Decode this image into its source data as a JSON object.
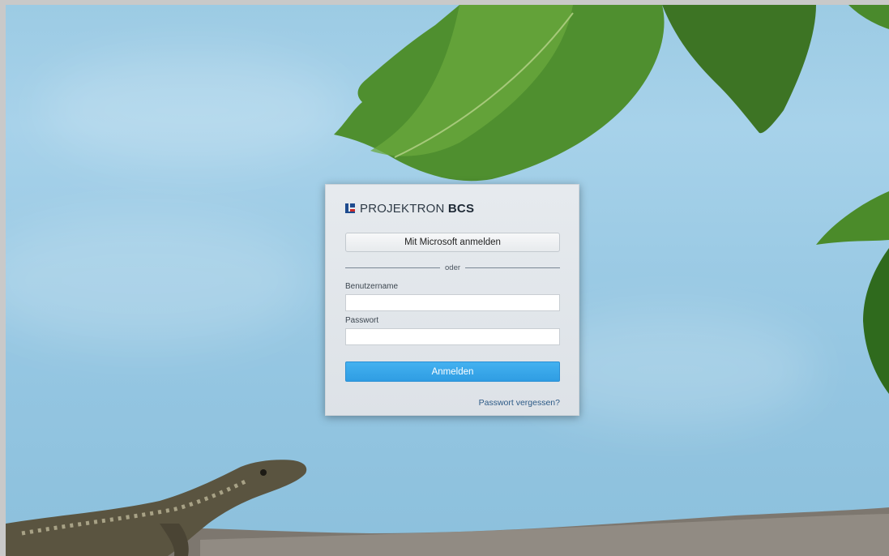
{
  "brand": {
    "name_regular": "PROJEKTRON",
    "name_bold": "BCS",
    "logo_icon": "projektron-logo-icon"
  },
  "login": {
    "microsoft_button_label": "Mit Microsoft anmelden",
    "divider_text": "oder",
    "username_label": "Benutzername",
    "username_value": "",
    "password_label": "Passwort",
    "password_value": "",
    "submit_label": "Anmelden",
    "forgot_password_label": "Passwort vergessen?"
  },
  "colors": {
    "accent": "#3aa7ea",
    "link": "#2c5a86",
    "logo_blue": "#1e4b8f",
    "logo_red": "#c92b2b"
  },
  "background": {
    "scene": "sky-with-leaves-and-lizard"
  }
}
